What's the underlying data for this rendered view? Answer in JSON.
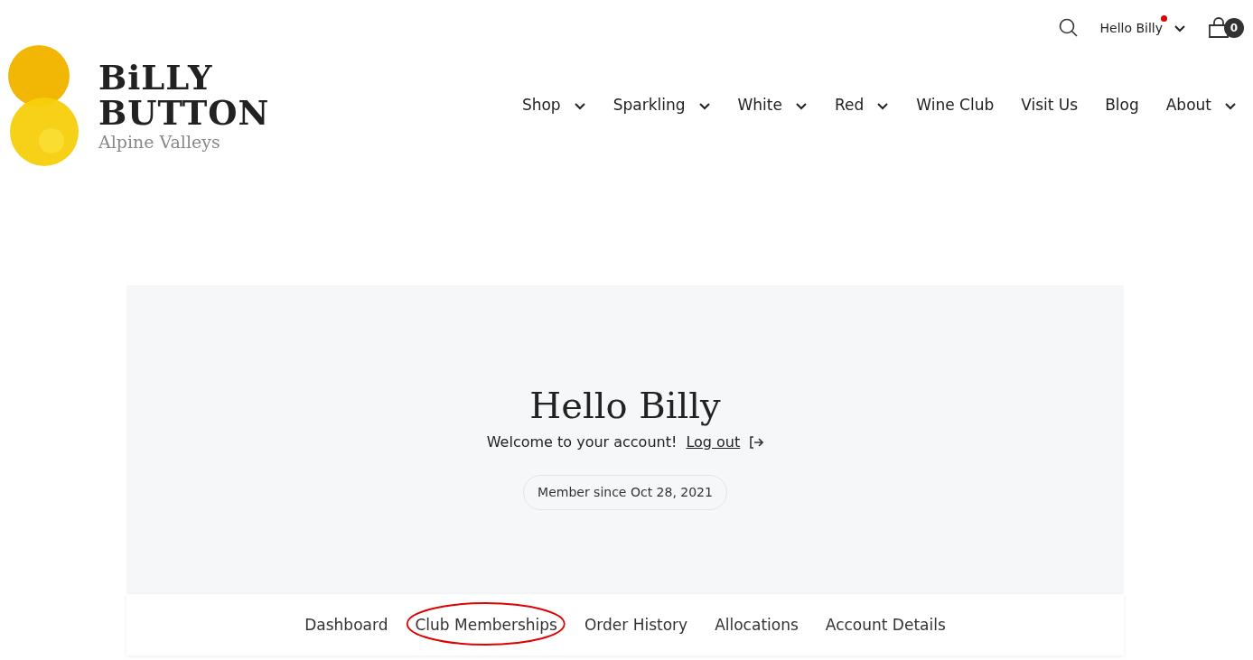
{
  "top_bar": {
    "greeting": "Hello Billy",
    "notification": true,
    "cart_count": "0"
  },
  "logo": {
    "line_1": "BiLLY",
    "line_2": "BUTTON",
    "tagline": "Alpine Valleys"
  },
  "nav": [
    {
      "label": "Shop",
      "dropdown": true
    },
    {
      "label": "Sparkling",
      "dropdown": true
    },
    {
      "label": "White",
      "dropdown": true
    },
    {
      "label": "Red",
      "dropdown": true
    },
    {
      "label": "Wine Club",
      "dropdown": false
    },
    {
      "label": "Visit Us",
      "dropdown": false
    },
    {
      "label": "Blog",
      "dropdown": false
    },
    {
      "label": "About",
      "dropdown": true
    }
  ],
  "account": {
    "title": "Hello Billy",
    "welcome": "Welcome to your account!",
    "logout": "Log out",
    "member_since": "Member since Oct 28, 2021"
  },
  "tabs": [
    {
      "label": "Dashboard",
      "circled": false
    },
    {
      "label": "Club Memberships",
      "circled": true
    },
    {
      "label": "Order History",
      "circled": false
    },
    {
      "label": "Allocations",
      "circled": false
    },
    {
      "label": "Account Details",
      "circled": false
    }
  ]
}
